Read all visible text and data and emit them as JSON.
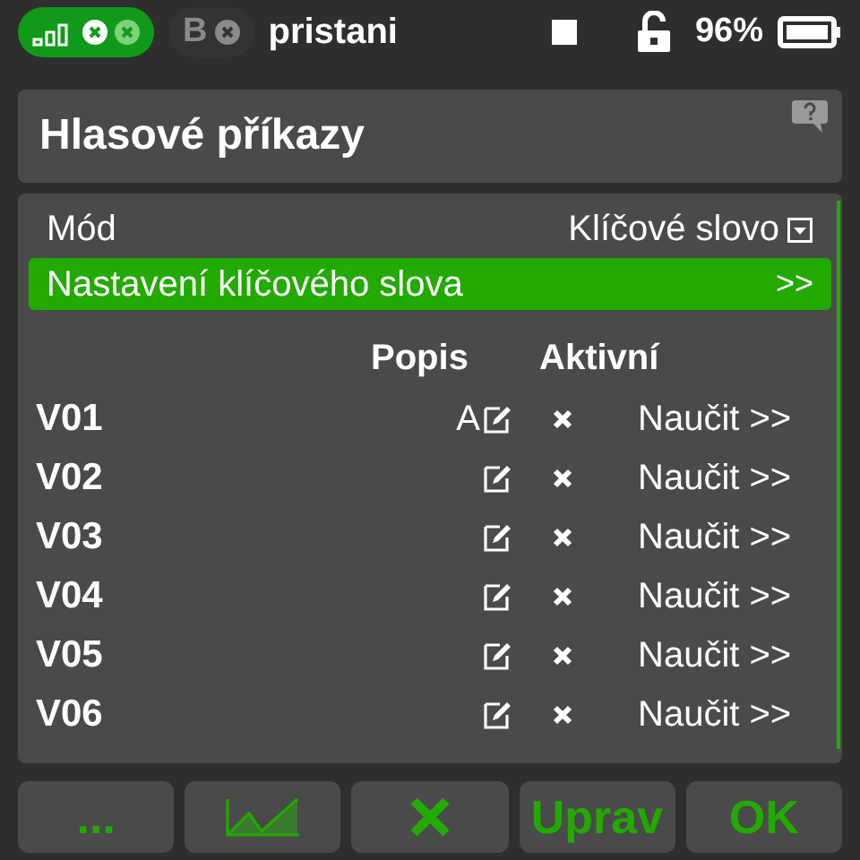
{
  "status_bar": {
    "module_badge": "B",
    "model_name": "pristani",
    "battery": "96%"
  },
  "title": "Hlasové příkazy",
  "mode": {
    "label": "Mód",
    "value": "Klíčové slovo"
  },
  "keyword_settings": {
    "label": "Nastavení klíčového slova",
    "arrow": ">>",
    "selected": true
  },
  "columns": [
    "Popis",
    "Aktivní"
  ],
  "rows": [
    {
      "name": "V01",
      "description": "A",
      "active": false,
      "action": "Naučit >>"
    },
    {
      "name": "V02",
      "active": false,
      "action": "Naučit >>"
    },
    {
      "name": "V03",
      "active": false,
      "action": "Naučit >>"
    },
    {
      "name": "V04",
      "active": false,
      "action": "Naučit >>"
    },
    {
      "name": "V05",
      "active": false,
      "action": "Naučit >>"
    },
    {
      "name": "V06",
      "active": false,
      "action": "Naučit >>"
    }
  ],
  "buttons": [
    {
      "kind": "text",
      "label": "..."
    },
    {
      "kind": "chart"
    },
    {
      "kind": "close"
    },
    {
      "kind": "text",
      "label": "Uprav"
    },
    {
      "kind": "text",
      "label": "OK"
    }
  ]
}
